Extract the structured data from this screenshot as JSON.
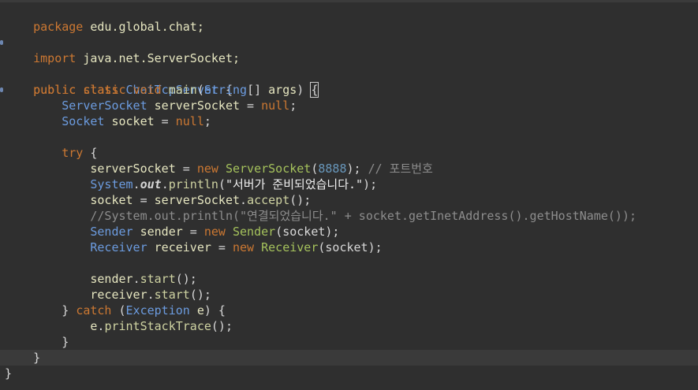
{
  "editor": {
    "language": "java",
    "colors": {
      "background": "#2f2f2f",
      "keyword": "#cc7832",
      "type": "#6c9ce0",
      "constructor": "#a5c25c",
      "identifier": "#e6e6c0",
      "comment": "#8d8d8d",
      "number": "#6897bb"
    },
    "code": {
      "l1_kw": "package",
      "l1_rest": " edu.global.chat;",
      "l3_kw": "import",
      "l3_rest": " java.net.ServerSocket;",
      "l5_kw1": "public",
      "l5_kw2": "class",
      "l5_cls": "ChatTcpServer",
      "l5_brace": " {",
      "l6_kw1": "public",
      "l6_kw2": "static",
      "l6_kw3": "void",
      "l6_meth": "main",
      "l6_p1": "(",
      "l6_type": "String",
      "l6_arr": "[] ",
      "l6_arg": "args",
      "l6_p2": ") ",
      "l6_brace": "{",
      "l7_type": "ServerSocket",
      "l7_var": "serverSocket",
      "l7_eq": " = ",
      "l7_null": "null",
      "l7_end": ";",
      "l8_type": "Socket",
      "l8_var": "socket",
      "l8_eq": " = ",
      "l8_null": "null",
      "l8_end": ";",
      "l10_kw": "try",
      "l10_brace": " {",
      "l11_var": "serverSocket",
      "l11_eq": " = ",
      "l11_new": "new",
      "l11_cls": "ServerSocket",
      "l11_p1": "(",
      "l11_num": "8888",
      "l11_p2": "); ",
      "l11_cmt": "// 포트번호",
      "l12_cls": "System",
      "l12_dot1": ".",
      "l12_out": "out",
      "l12_dot2": ".",
      "l12_meth": "println",
      "l12_p1": "(",
      "l12_str": "\"서버가 준비되었습니다.\"",
      "l12_p2": ");",
      "l13_var": "socket",
      "l13_eq": " = ",
      "l13_obj": "serverSocket",
      "l13_dot": ".",
      "l13_meth": "accept",
      "l13_end": "();",
      "l14_cmt": "//System.out.println(\"연결되었습니다.\" + socket.getInetAddress().getHostName());",
      "l15_type": "Sender",
      "l15_var": "sender",
      "l15_eq": " = ",
      "l15_new": "new",
      "l15_cls": "Sender",
      "l15_arg": "(socket);",
      "l16_type": "Receiver",
      "l16_var": "receiver",
      "l16_eq": " = ",
      "l16_new": "new",
      "l16_cls": "Receiver",
      "l16_arg": "(socket);",
      "l18_obj": "sender",
      "l18_dot": ".",
      "l18_meth": "start",
      "l18_end": "();",
      "l19_obj": "receiver",
      "l19_dot": ".",
      "l19_meth": "start",
      "l19_end": "();",
      "l20_close": "} ",
      "l20_kw": "catch",
      "l20_p1": " (",
      "l20_type": "Exception",
      "l20_var": " e",
      "l20_p2": ") {",
      "l21_obj": "e",
      "l21_dot": ".",
      "l21_meth": "printStackTrace",
      "l21_end": "();",
      "l22_close": "}",
      "l23_close": "}",
      "l24_close": "}"
    }
  }
}
